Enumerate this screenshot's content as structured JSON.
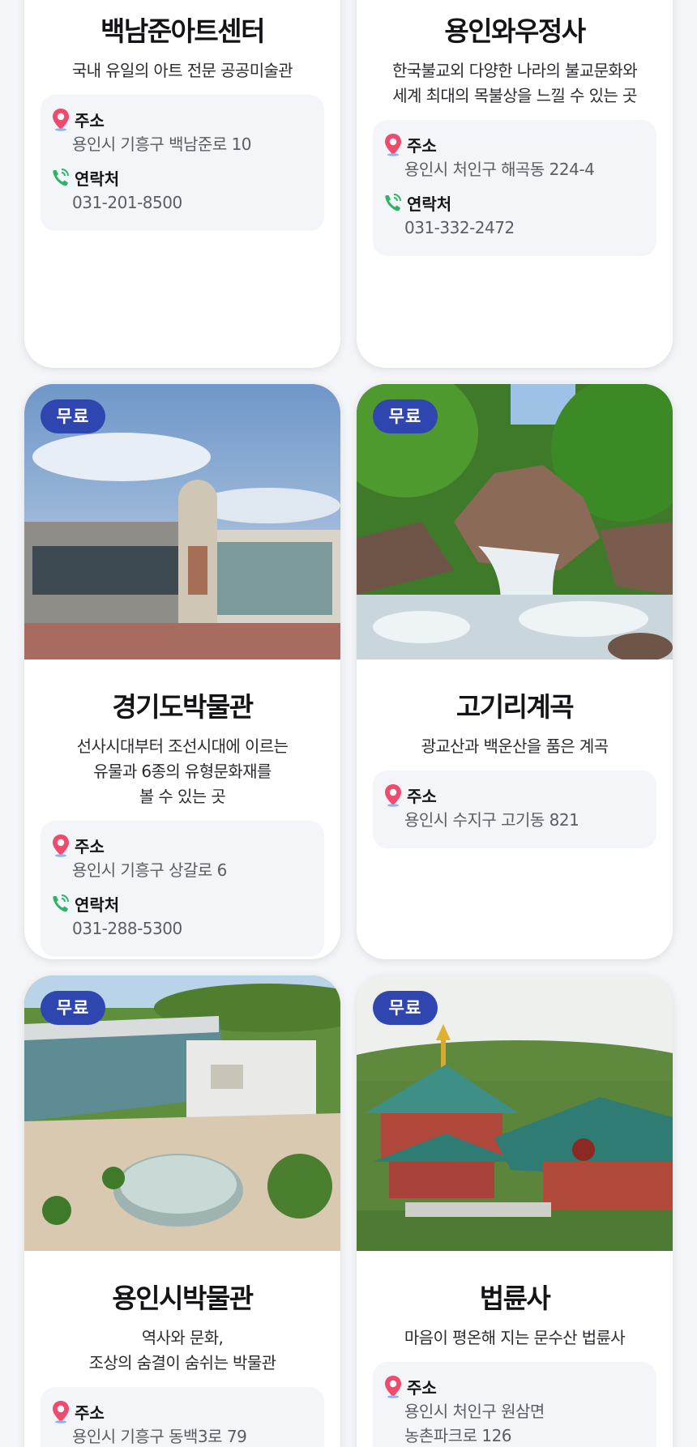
{
  "labels": {
    "address": "주소",
    "contact": "연락처",
    "free": "무료"
  },
  "cards": [
    {
      "title": "백남준아트센터",
      "desc": "국내 유일의 아트 전문 공공미술관",
      "address": "용인시 기흥구 백남준로 10",
      "contact": "031-201-8500",
      "free": false
    },
    {
      "title": "용인와우정사",
      "desc": "한국불교외 다양한 나라의 불교문화와\n세계 최대의 목불상을 느낄 수 있는 곳",
      "address": "용인시 처인구 해곡동 224-4",
      "contact": "031-332-2472",
      "free": false
    },
    {
      "title": "경기도박물관",
      "desc": "선사시대부터 조선시대에 이르는\n유물과 6종의 유형문화재를\n볼 수 있는 곳",
      "address": "용인시 기흥구 상갈로 6",
      "contact": "031-288-5300",
      "free": true
    },
    {
      "title": "고기리계곡",
      "desc": "광교산과 백운산을 품은 계곡",
      "address": "용인시 수지구 고기동 821",
      "free": true
    },
    {
      "title": "용인시박물관",
      "desc": "역사와 문화,\n조상의 숨결이 숨쉬는 박물관",
      "address": "용인시 기흥구 동백3로 79",
      "free": true
    },
    {
      "title": "법륜사",
      "desc": "마음이 평온해 지는 문수산 법륜사",
      "address": "용인시 처인구 원삼면\n농촌파크로 126",
      "free": true
    }
  ]
}
